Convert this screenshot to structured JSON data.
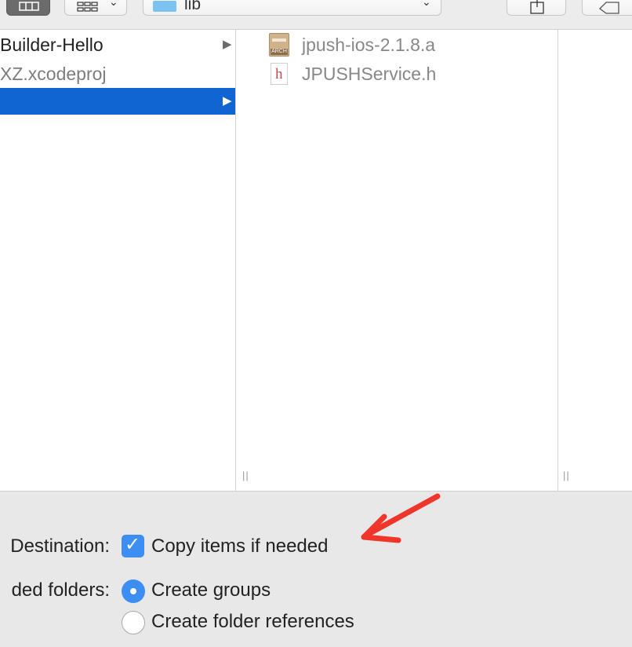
{
  "toolbar": {
    "path_label": "lib",
    "arrange_icon": "grid-icon",
    "share_icon": "share-icon",
    "tag_icon": "tag-icon"
  },
  "browser": {
    "left_column": [
      {
        "label": "Builder-Hello",
        "has_children": true,
        "selected": false
      },
      {
        "label": "XZ.xcodeproj",
        "has_children": false,
        "selected": false
      },
      {
        "label": "",
        "has_children": true,
        "selected": true
      }
    ],
    "files": [
      {
        "name": "jpush-ios-2.1.8.a",
        "icon": "archive-file-icon",
        "badge": "ARCH"
      },
      {
        "name": "JPUSHService.h",
        "icon": "header-file-icon",
        "badge": "h"
      }
    ]
  },
  "options": {
    "destination_label": "Destination:",
    "copy_items_label": "Copy items if needed",
    "copy_items_checked": true,
    "added_folders_label": "ded folders:",
    "create_groups_label": "Create groups",
    "create_folder_refs_label": "Create folder references",
    "selected_folder_option": "Create groups"
  },
  "colors": {
    "selection": "#1065d3",
    "accent": "#3d8ef3",
    "annotation_arrow": "#f0352a"
  }
}
